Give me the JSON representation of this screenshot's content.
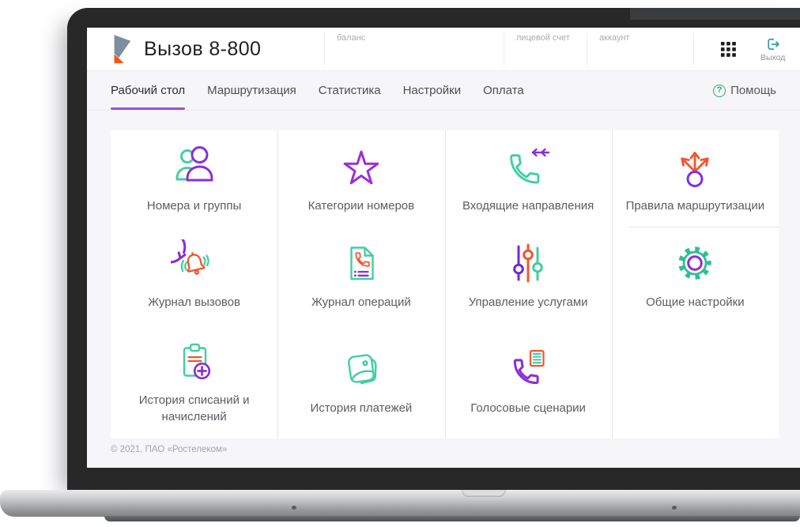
{
  "brand": {
    "title": "Вызов 8-800",
    "logo": "rostelecom-mark"
  },
  "header": {
    "fields": [
      {
        "label": "баланс"
      },
      {
        "label": "лицевой счет"
      },
      {
        "label": "аккаунт"
      }
    ],
    "apps_icon": "apps-grid",
    "logout": {
      "label": "Выход",
      "icon": "logout-arrow"
    }
  },
  "nav": {
    "tabs": [
      {
        "label": "Рабочий стол",
        "active": true
      },
      {
        "label": "Маршрутизация",
        "active": false
      },
      {
        "label": "Статистика",
        "active": false
      },
      {
        "label": "Настройки",
        "active": false
      },
      {
        "label": "Оплата",
        "active": false
      }
    ],
    "help": {
      "icon_char": "?",
      "label": "Помощь"
    }
  },
  "tiles": [
    {
      "label": "Номера и группы",
      "icon": "people"
    },
    {
      "label": "Категории номеров",
      "icon": "star"
    },
    {
      "label": "Входящие направления",
      "icon": "phone-incoming-arrows"
    },
    {
      "label": "Правила маршрутизации",
      "icon": "route-split-arrows"
    },
    {
      "label": "Журнал вызовов",
      "icon": "bell-circular-arrow"
    },
    {
      "label": "Журнал операций",
      "icon": "document-phone-list"
    },
    {
      "label": "Управление услугами",
      "icon": "vertical-sliders"
    },
    {
      "label": "Общие настройки",
      "icon": "gear"
    },
    {
      "label": "История списаний и начислений",
      "icon": "clipboard-plus"
    },
    {
      "label": "История платежей",
      "icon": "wallet"
    },
    {
      "label": "Голосовые сценарии",
      "icon": "phone-script"
    }
  ],
  "footer": {
    "copyright": "© 2021, ПАО «Ростелеком»"
  },
  "colors": {
    "accent_purple": "#9b51e0",
    "icon_purple": "#8b2fd6",
    "icon_teal": "#3fcf9f",
    "icon_orange": "#f2552c",
    "help_green": "#2bae66",
    "logo_slate": "#7d8e9e",
    "logo_orange": "#ff4f12"
  }
}
